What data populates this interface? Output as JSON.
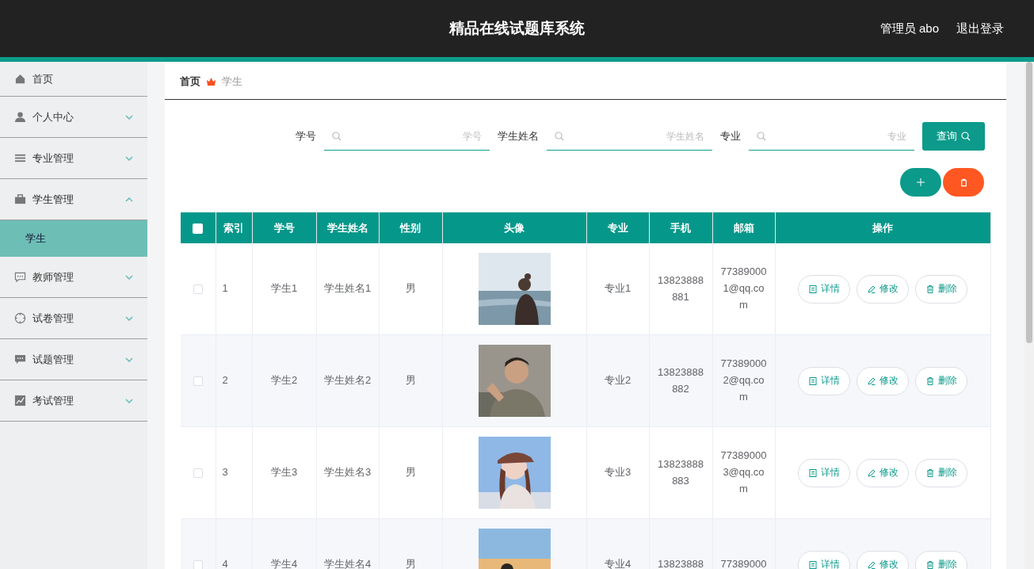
{
  "header": {
    "title": "精品在线试题库系统",
    "user": "管理员 abo",
    "logout": "退出登录"
  },
  "sidebar": {
    "items": [
      {
        "label": "首页",
        "kind": "link"
      },
      {
        "label": "个人中心",
        "kind": "menu",
        "expanded": false
      },
      {
        "label": "专业管理",
        "kind": "menu",
        "expanded": false
      },
      {
        "label": "学生管理",
        "kind": "menu",
        "expanded": true,
        "children": [
          {
            "label": "学生",
            "selected": true
          }
        ]
      },
      {
        "label": "教师管理",
        "kind": "menu",
        "expanded": false
      },
      {
        "label": "试卷管理",
        "kind": "menu",
        "expanded": false
      },
      {
        "label": "试题管理",
        "kind": "menu",
        "expanded": false
      },
      {
        "label": "考试管理",
        "kind": "menu",
        "expanded": false
      }
    ]
  },
  "breadcrumb": [
    "首页",
    "学生"
  ],
  "search": {
    "fields": [
      {
        "label": "学号",
        "placeholder": "学号"
      },
      {
        "label": "学生姓名",
        "placeholder": "学生姓名"
      },
      {
        "label": "专业",
        "placeholder": "专业"
      }
    ],
    "button": "查询"
  },
  "table": {
    "all_checked": false,
    "columns": [
      "索引",
      "学号",
      "学生姓名",
      "性别",
      "头像",
      "专业",
      "手机",
      "邮箱",
      "操作"
    ],
    "rows": [
      {
        "checked": false,
        "index": "1",
        "student_id": "学生1",
        "name": "学生姓名1",
        "gender": "男",
        "avatar": {
          "kind": "picture"
        },
        "major": "专业1",
        "phone": "13823888881",
        "email": "773890001@qq.com",
        "actions": [
          "详情",
          "修改",
          "删除"
        ]
      },
      {
        "checked": false,
        "index": "2",
        "student_id": "学生2",
        "name": "学生姓名2",
        "gender": "男",
        "avatar": {
          "kind": "picture"
        },
        "major": "专业2",
        "phone": "13823888882",
        "email": "773890002@qq.com",
        "actions": [
          "详情",
          "修改",
          "删除"
        ]
      },
      {
        "checked": false,
        "index": "3",
        "student_id": "学生3",
        "name": "学生姓名3",
        "gender": "男",
        "avatar": {
          "kind": "picture"
        },
        "major": "专业3",
        "phone": "13823888883",
        "email": "773890003@qq.com",
        "actions": [
          "详情",
          "修改",
          "删除"
        ]
      },
      {
        "checked": false,
        "index": "4",
        "student_id": "学生4",
        "name": "学生姓名4",
        "gender": "男",
        "avatar": {
          "kind": "picture"
        },
        "major": "专业4",
        "phone": "13823888",
        "email": "77389000",
        "actions": [
          "详情",
          "修改",
          "删除"
        ]
      }
    ]
  }
}
